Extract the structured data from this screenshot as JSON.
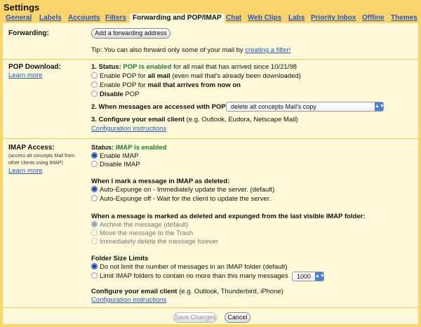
{
  "title": "Settings",
  "tabs": [
    {
      "label": "General"
    },
    {
      "label": "Labels"
    },
    {
      "label": "Accounts"
    },
    {
      "label": "Filters"
    },
    {
      "label": "Forwarding and POP/IMAP",
      "active": true
    },
    {
      "label": "Chat"
    },
    {
      "label": "Web Clips"
    },
    {
      "label": "Labs"
    },
    {
      "label": "Priority Inbox"
    },
    {
      "label": "Offline"
    },
    {
      "label": "Themes"
    }
  ],
  "forwarding": {
    "label": "Forwarding:",
    "button": "Add a forwarding address",
    "tip": "Tip: You can also forward only some of your mail by ",
    "tip_link": "creating a filter!"
  },
  "pop": {
    "label": "POP Download:",
    "learn_more": "Learn more",
    "status_prefix": "1. Status: ",
    "status": "POP is enabled",
    "status_suffix": " for all mail that has arrived since 10/21/98",
    "options": [
      {
        "pre": "Enable POP for ",
        "bold": "all mail",
        "post": " (even mail that's already been downloaded)"
      },
      {
        "pre": "Enable POP for ",
        "bold": "mail that arrives from now on",
        "post": ""
      },
      {
        "pre": "",
        "bold": "Disable",
        "post": " POP"
      }
    ],
    "access_label": "2. When messages are accessed with POP",
    "access_value": "delete alt concepts Mail's copy",
    "client_bold": "3. Configure your email client",
    "client_rest": " (e.g. Outlook, Eudora, Netscape Mail)",
    "config_link": "Configuration instructions"
  },
  "imap": {
    "label": "IMAP Access:",
    "sub1": "(access alt concepts Mail from",
    "sub2": "other clients using IMAP)",
    "learn_more": "Learn more",
    "status_prefix": "Status: ",
    "status": "IMAP is enabled",
    "enable": "Enable IMAP",
    "disable": "Disable IMAP",
    "deleted_heading": "When I mark a message in IMAP as deleted:",
    "expunge_on": "Auto-Expunge on - Immediately update the server. (default)",
    "expunge_off": "Auto-Expunge off - Wait for the client to update the server.",
    "expunged_heading": "When a message is marked as deleted and expunged from the last visible IMAP folder:",
    "archive": "Archive the message (default)",
    "trash": "Move the message to the Trash",
    "forever": "Immediately delete the message forever",
    "folder_heading": "Folder Size Limits",
    "no_limit": "Do not limit the number of messages in an IMAP folder (default)",
    "limit": "Limit IMAP folders to contain no more than this many messages",
    "limit_value": "1000",
    "client_bold": "Configure your email client",
    "client_rest": " (e.g. Outlook, Thunderbird, iPhone)",
    "config_link": "Configuration instructions"
  },
  "footer": {
    "save": "Save Changes",
    "cancel": "Cancel"
  }
}
